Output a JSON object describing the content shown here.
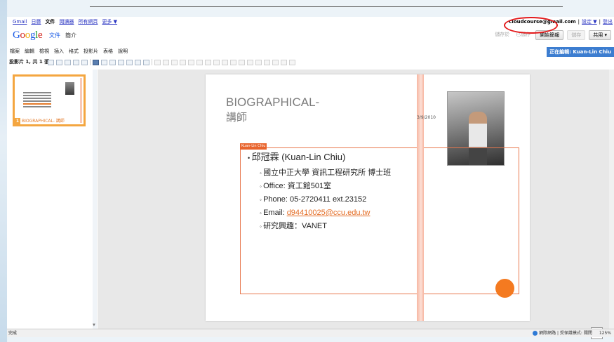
{
  "gbar": {
    "links": [
      "Gmail",
      "日曆",
      "文件",
      "閱讀器",
      "所有網頁",
      "更多 ▼"
    ],
    "current_index": 2,
    "email": "cloudcourse@gmail.com",
    "settings": "設定 ▼",
    "signout": "登出"
  },
  "header": {
    "product": "文件",
    "doc_title": "簡介",
    "buttons": {
      "saved": "儲存於",
      "revert": "已儲存",
      "start_presentation": "開始簡報",
      "disabled_btn": "儲存",
      "share": "共用 ▾"
    }
  },
  "menubar": {
    "items": [
      "檔案",
      "編輯",
      "檢視",
      "插入",
      "格式",
      "投影片",
      "表格",
      "說明"
    ],
    "edit_status": "正在編輯: Kuan-Lin Chiu"
  },
  "toolbar": {
    "slide_count": "投影片 1, 共 1 張"
  },
  "thumbnail": {
    "number": "1",
    "label": "BIOGRAPHICAL- 講師"
  },
  "slide": {
    "title": "BIOGRAPHICAL-",
    "subtitle": "講師",
    "date": "3/9/2010",
    "box_tag": "Kuan-Lin Chiu",
    "name": "邱冠霖 (Kuan-Lin Chiu)",
    "details": [
      "國立中正大學 資訊工程研究所 博士班",
      "Office: 資工館501室",
      "Phone: 05-2720411 ext.23152"
    ],
    "email_label": "Email: ",
    "email": "d94410025@ccu.edu.tw",
    "interest": "研究興趣：VANET"
  },
  "statusbar": {
    "left": "完成",
    "network": "網際網路 | 受保護模式: 關閉",
    "zoom": "125%"
  },
  "colors": {
    "accent_orange": "#f47a20",
    "link_blue": "#2a35c2",
    "highlight_circle": "#e3191b"
  }
}
